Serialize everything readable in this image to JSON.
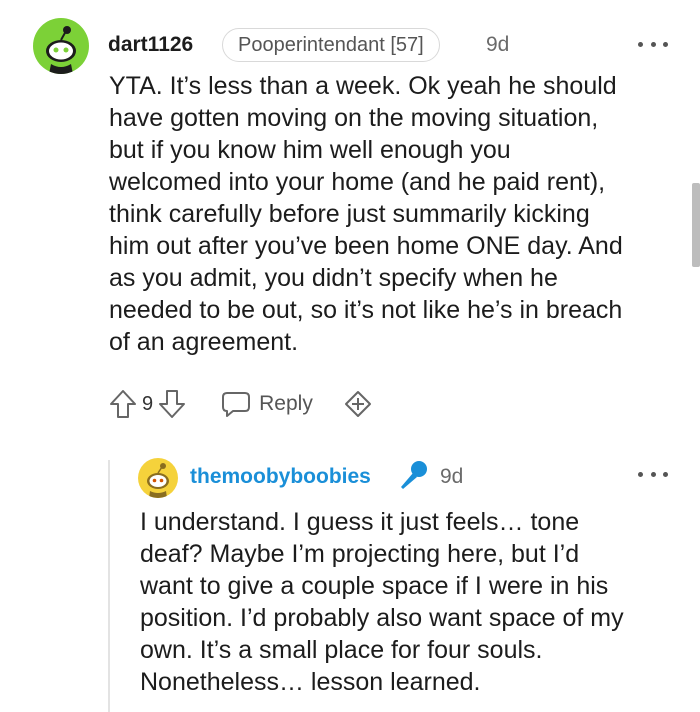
{
  "comment1": {
    "username": "dart1126",
    "flair": "Pooperintendant [57]",
    "time": "9d",
    "lines": [
      "YTA. It’s less than a week. Ok yeah he should",
      "have gotten moving on the moving situation,",
      "but if you know him well enough you",
      "welcomed into your home (and he paid rent),",
      "think carefully before just summarily kicking",
      "him out after you’ve been home ONE day. And",
      "as you admit, you didn’t specify when he",
      "needed to be out, so it’s not like he’s in breach",
      "of an agreement."
    ],
    "votes": "9",
    "reply_label": "Reply"
  },
  "comment2": {
    "username": "themoobyboobies",
    "time": "9d",
    "lines": [
      "I understand. I guess it just feels… tone",
      "deaf? Maybe I’m projecting here, but I’d",
      "want to give a couple space if I were in his",
      "position. I’d probably also want space of my",
      "own. It’s a small place for four souls.",
      "Nonetheless… lesson learned."
    ]
  },
  "icons": {
    "more": "more-horizontal-icon",
    "upvote": "upvote-arrow-icon",
    "downvote": "downvote-arrow-icon",
    "reply": "speech-bubble-icon",
    "award": "add-award-icon",
    "mic": "microphone-icon"
  },
  "colors": {
    "avatar1_bg": "#7cd137",
    "avatar2_bg": "#f5d23b",
    "op_username": "#1a8fd8",
    "mic": "#1a8fd8"
  }
}
